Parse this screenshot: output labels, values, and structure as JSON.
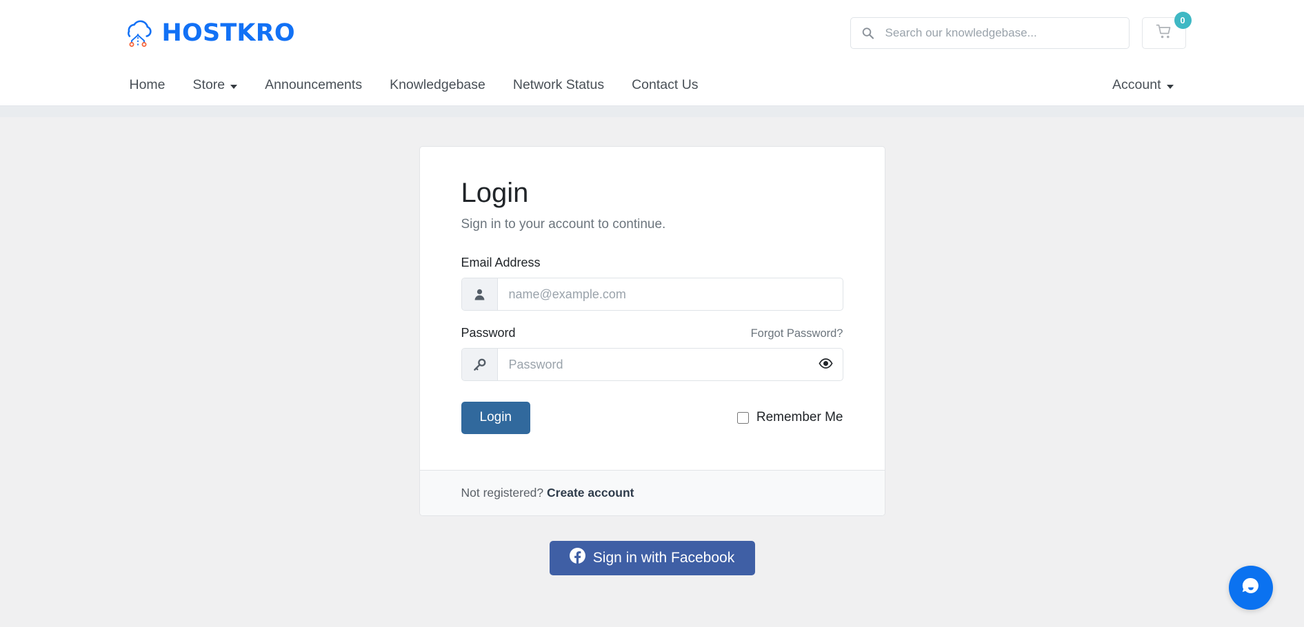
{
  "brand": {
    "name": "HOSTKRO",
    "logo_icon": "cloud-network-icon",
    "color": "#1271f5"
  },
  "header": {
    "search": {
      "placeholder": "Search our knowledgebase...",
      "value": "",
      "icon": "search-icon"
    },
    "cart": {
      "icon": "shopping-cart-icon",
      "count": "0",
      "badge_color": "#3fb8c4"
    }
  },
  "nav": {
    "items": [
      {
        "label": "Home",
        "has_caret": false
      },
      {
        "label": "Store",
        "has_caret": true
      },
      {
        "label": "Announcements",
        "has_caret": false
      },
      {
        "label": "Knowledgebase",
        "has_caret": false
      },
      {
        "label": "Network Status",
        "has_caret": false
      },
      {
        "label": "Contact Us",
        "has_caret": false
      }
    ],
    "account": {
      "label": "Account",
      "has_caret": true
    }
  },
  "login": {
    "title": "Login",
    "subtitle": "Sign in to your account to continue.",
    "email": {
      "label": "Email Address",
      "placeholder": "name@example.com",
      "value": "",
      "icon": "user-icon"
    },
    "password": {
      "label": "Password",
      "placeholder": "Password",
      "value": "",
      "icon": "key-icon",
      "toggle_icon": "eye-icon",
      "forgot_label": "Forgot Password?"
    },
    "submit_label": "Login",
    "remember_label": "Remember Me",
    "remember_checked": false,
    "submit_color": "#31699d",
    "footer": {
      "text": "Not registered?",
      "link_label": "Create account"
    }
  },
  "social": {
    "facebook": {
      "label": "Sign in with Facebook",
      "icon": "facebook-icon",
      "color": "#3f5fa5"
    }
  },
  "chat": {
    "icon": "chat-bubble-icon",
    "color": "#0b72f0"
  }
}
